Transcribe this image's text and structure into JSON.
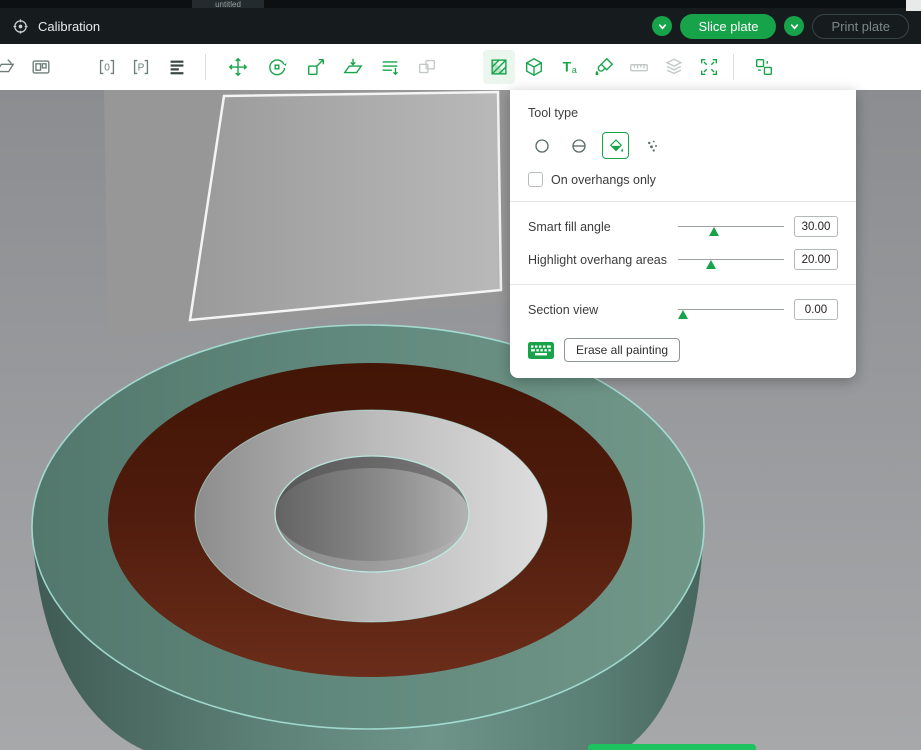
{
  "window": {
    "tab": "untitled"
  },
  "topbar": {
    "title": "Calibration",
    "slice_button": "Slice plate",
    "print_button": "Print plate"
  },
  "toolbar": {
    "plate_zero": "0",
    "plate_p": "P",
    "text_t": "T",
    "text_a": "a",
    "icons": [
      "plate-edit",
      "arrange",
      "plate-lock-0",
      "plate-settings-p",
      "layer-rows",
      "move",
      "rotate",
      "scale",
      "lay-flat",
      "layer-height",
      "merge",
      "support-paint",
      "color-paint",
      "text",
      "paint-fill",
      "measure",
      "assembly",
      "split-objects",
      "split-parts"
    ]
  },
  "panel": {
    "tool_type_label": "Tool type",
    "overhangs_label": "On overhangs only",
    "sliders": [
      {
        "label": "Smart fill angle",
        "value": "30.00",
        "percent": 34
      },
      {
        "label": "Highlight overhang areas",
        "value": "20.00",
        "percent": 31
      },
      {
        "label": "Section view",
        "value": "0.00",
        "percent": 5
      }
    ],
    "erase_button": "Erase all painting"
  },
  "colors": {
    "accent_green": "#17a34a",
    "model_teal": "#628a7e",
    "model_maroon": "#531d0e",
    "model_silver": "#c0c0c0",
    "highlight_cyan": "#aeeae0"
  }
}
